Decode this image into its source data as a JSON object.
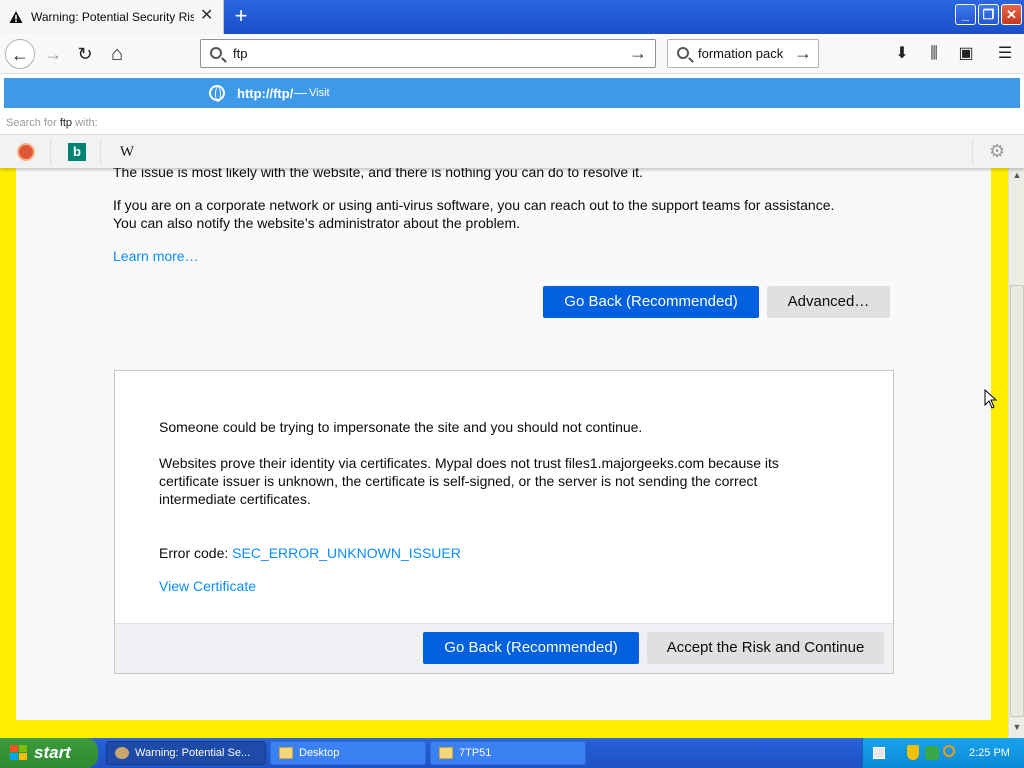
{
  "browser": {
    "tab": {
      "title": "Warning: Potential Security Risk Ahead",
      "close_glyph": "✕"
    },
    "new_tab_glyph": "+",
    "window_buttons": {
      "minimize": "_",
      "restore": "❐",
      "close": "✕"
    },
    "urlbar": {
      "value": "ftp",
      "go_glyph": "→"
    },
    "searchbar": {
      "value": "formation pack",
      "go_glyph": "→"
    },
    "nav_glyphs": {
      "back": "←",
      "forward": "→",
      "reload": "↻",
      "home": "⌂"
    },
    "toolbar_glyphs": {
      "downloads": "⬇",
      "library": "⫼",
      "sidebar": "▣",
      "menu": "☰"
    }
  },
  "autocomplete": {
    "suggestion_url": "http://ftp/",
    "suggestion_dash": "—",
    "suggestion_action": "Visit",
    "search_for_prefix": "Search for",
    "search_for_term": "ftp",
    "search_for_suffix": "with:",
    "engines": [
      "DuckDuckGo",
      "Bing",
      "Wikipedia"
    ],
    "bing_glyph": "b",
    "wiki_glyph": "W",
    "settings_glyph": "⚙"
  },
  "page": {
    "partial_line": "The issue is most likely with the website, and there is nothing you can do to resolve it.",
    "corporate_line1": "If you are on a corporate network or using anti-virus software, you can reach out to the support teams for assistance.",
    "corporate_line2": "You can also notify the website’s administrator about the problem.",
    "learn_more": "Learn more…",
    "go_back_label": "Go Back (Recommended)",
    "advanced_label": "Advanced…",
    "advanced": {
      "impersonate": "Someone could be trying to impersonate the site and you should not continue.",
      "cert_line1": "Websites prove their identity via certificates. Mypal does not trust files1.majorgeeks.com because its",
      "cert_line2": "certificate issuer is unknown, the certificate is self-signed, or the server is not sending the correct",
      "cert_line3": "intermediate certificates.",
      "error_code_label": "Error code:",
      "error_code": "SEC_ERROR_UNKNOWN_ISSUER",
      "view_certificate": "View Certificate",
      "go_back_label": "Go Back (Recommended)",
      "accept_label": "Accept the Risk and Continue"
    }
  },
  "taskbar": {
    "start_label": "start",
    "tasks": [
      "Warning: Potential Se...",
      "Desktop",
      "7TP51"
    ],
    "clock": "2:25 PM"
  },
  "colors": {
    "accent_blue": "#0060df",
    "suggestion_highlight": "#3d9ae8",
    "page_border": "#ffee00",
    "link": "#0a8dff"
  }
}
